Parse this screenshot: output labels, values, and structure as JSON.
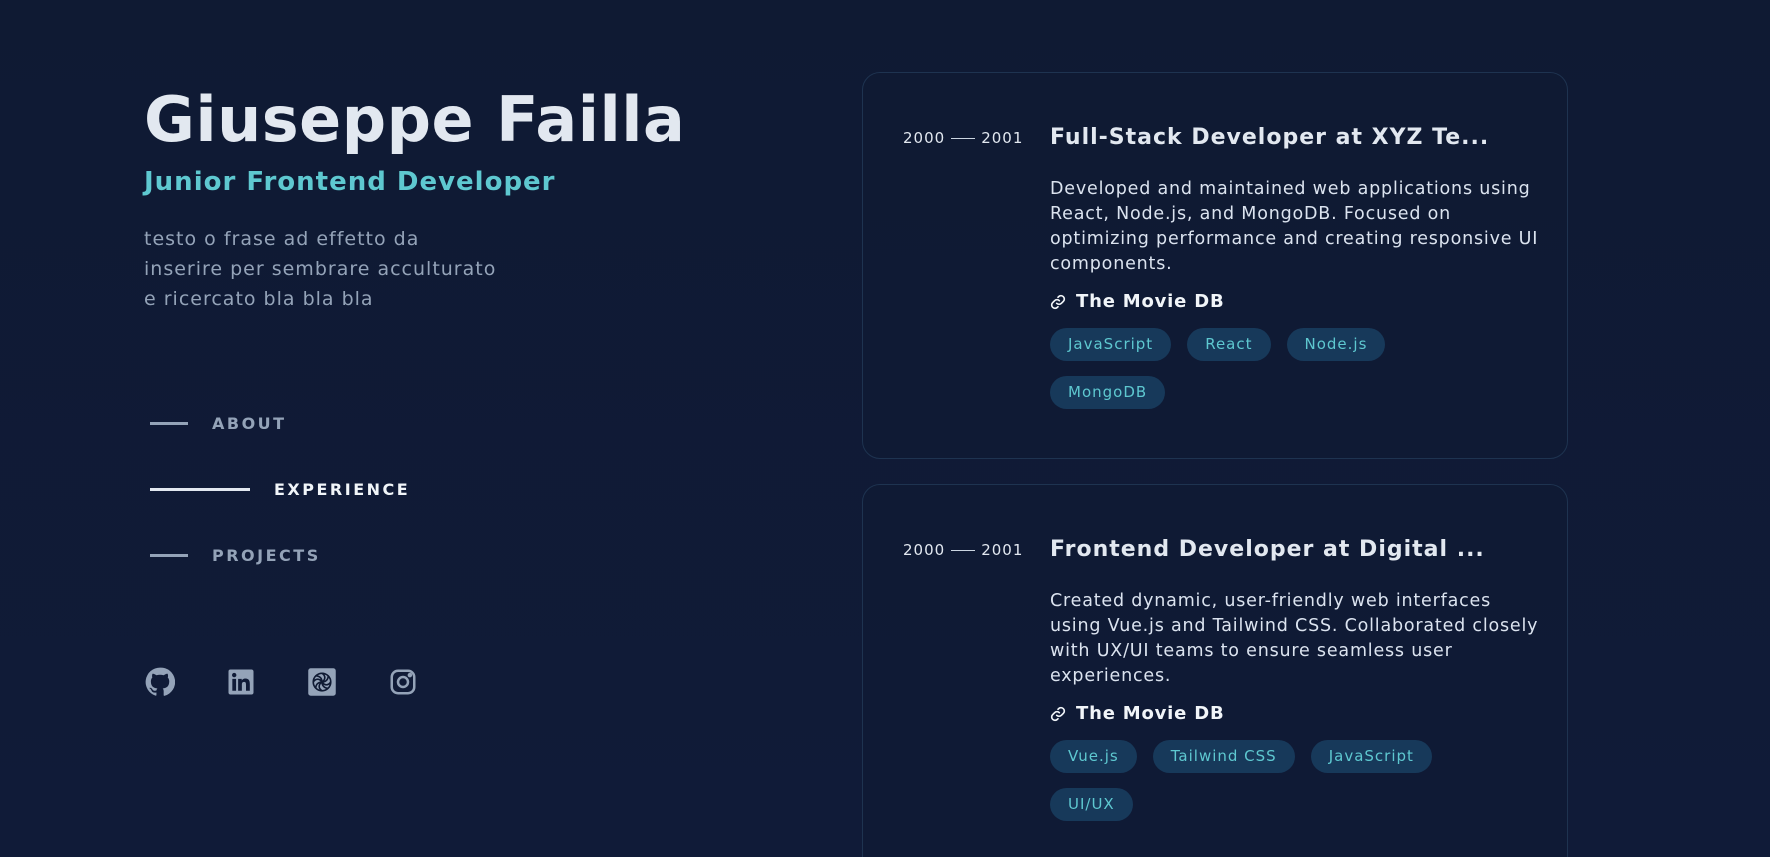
{
  "profile": {
    "name": "Giuseppe Failla",
    "role": "Junior Frontend Developer",
    "tagline": "testo o frase ad effetto da inserire per sembrare acculturato e ricercato bla bla bla"
  },
  "nav": {
    "items": [
      {
        "label": "ABOUT",
        "active": false
      },
      {
        "label": "EXPERIENCE",
        "active": true
      },
      {
        "label": "PROJECTS",
        "active": false
      }
    ]
  },
  "socials": [
    {
      "icon": "github-icon"
    },
    {
      "icon": "linkedin-icon"
    },
    {
      "icon": "codepen-spiral-icon"
    },
    {
      "icon": "instagram-icon"
    }
  ],
  "experience": [
    {
      "start": "2000",
      "end": "2001",
      "title": "Full-Stack Developer at XYZ Te...",
      "description": "Developed and maintained web applications using React, Node.js, and MongoDB. Focused on optimizing performance and creating responsive UI components.",
      "link": "The Movie DB",
      "tags": [
        "JavaScript",
        "React",
        "Node.js",
        "MongoDB"
      ]
    },
    {
      "start": "2000",
      "end": "2001",
      "title": "Frontend Developer at Digital ...",
      "description": "Created dynamic, user-friendly web interfaces using Vue.js and Tailwind CSS. Collaborated closely with UX/UI teams to ensure seamless user experiences.",
      "link": "The Movie DB",
      "tags": [
        "Vue.js",
        "Tailwind CSS",
        "JavaScript",
        "UI/UX"
      ]
    }
  ],
  "colors": {
    "background": "#0f1a33",
    "accent": "#5ec8d0",
    "muted": "#94a3b8",
    "text": "#e2e8f0",
    "tag_bg": "#17395a",
    "card_border": "#1e3350"
  }
}
